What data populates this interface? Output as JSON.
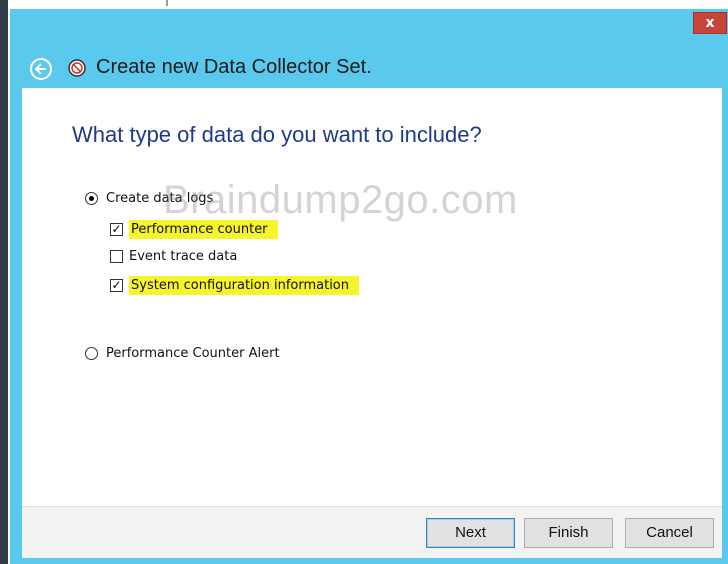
{
  "window": {
    "close_label": "x",
    "title": "Create new Data Collector Set."
  },
  "page": {
    "heading": "What type of data do you want to include?"
  },
  "options": {
    "create_data_logs": {
      "label": "Create data logs",
      "selected": true
    },
    "performance_counter": {
      "label": "Performance counter",
      "checked": true,
      "highlighted": true
    },
    "event_trace_data": {
      "label": "Event trace data",
      "checked": false
    },
    "system_configuration": {
      "label": "System configuration information",
      "checked": true,
      "highlighted": true
    },
    "performance_counter_alert": {
      "label": "Performance Counter Alert",
      "selected": false
    }
  },
  "watermark": "Braindump2go.com",
  "buttons": {
    "next": "Next",
    "finish": "Finish",
    "cancel": "Cancel"
  },
  "colors": {
    "titlebar": "#5bc9ee",
    "close": "#c7443a",
    "heading": "#1e3a8a",
    "highlight": "#f6f42a"
  },
  "icons": [
    "back-arrow-icon",
    "data-collector-icon",
    "close-icon"
  ]
}
